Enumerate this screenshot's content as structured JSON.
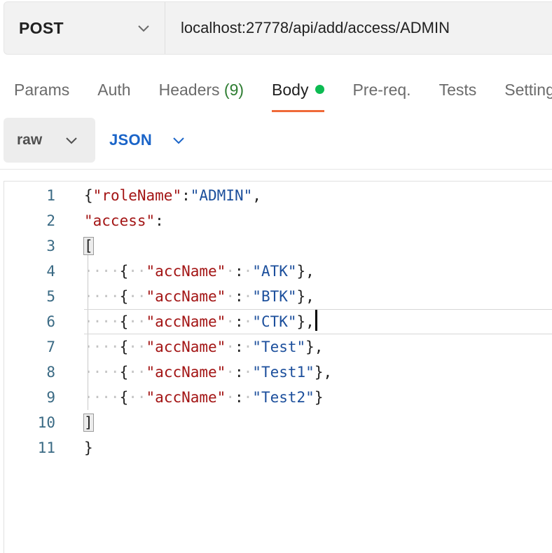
{
  "request": {
    "method": "POST",
    "url": "localhost:27778/api/add/access/ADMIN"
  },
  "tabs": {
    "params": "Params",
    "auth": "Auth",
    "headers": "Headers",
    "headers_count": "(9)",
    "body": "Body",
    "prereq": "Pre-req.",
    "tests": "Tests",
    "settings": "Settings",
    "active": "Body"
  },
  "body_options": {
    "mode": "raw",
    "language": "JSON"
  },
  "editor": {
    "line_numbers": [
      "1",
      "2",
      "3",
      "4",
      "5",
      "6",
      "7",
      "8",
      "9",
      "10",
      "11"
    ],
    "current_line": 6
  },
  "colors": {
    "accent_underline": "#ef6a39",
    "body_dot": "#0cbb52",
    "json_key": "#a31515",
    "json_string": "#1c4f9c",
    "language_label": "#1a64c8"
  },
  "icons": {
    "method_dropdown": "chevron-down-icon",
    "mode_dropdown": "chevron-down-icon",
    "language_dropdown": "chevron-down-icon"
  }
}
